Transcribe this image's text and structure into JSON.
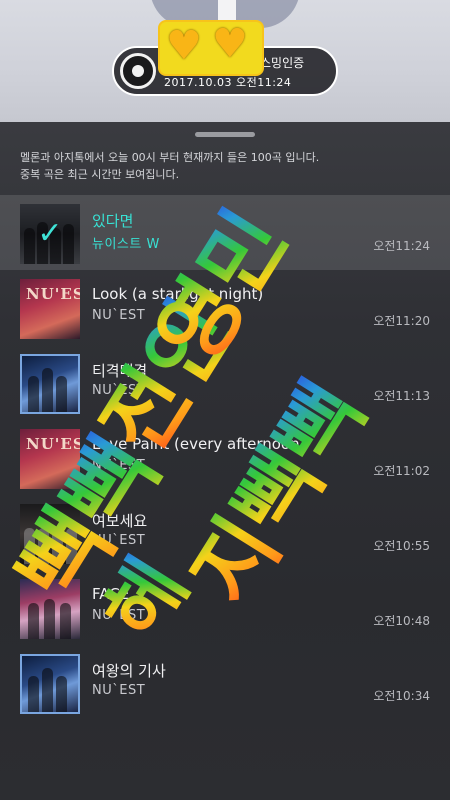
{
  "now_playing": {
    "title": "스밍인증",
    "title_prefix": "",
    "datetime": "2017.10.03 오전11:24"
  },
  "notice": {
    "line1": "멜론과 아지톡에서 오늘 00시 부터 현재까지 들은 100곡 입니다.",
    "line2": "중복 곡은 최근 시간만 보여집니다."
  },
  "songs": [
    {
      "title": "있다면",
      "artist": "뉴이스트 W",
      "time": "오전11:24",
      "selected": true
    },
    {
      "title": "Look (a starlight night)",
      "artist": "NU`EST",
      "time": "오전11:20"
    },
    {
      "title": "티격태격",
      "artist": "NU`EST",
      "time": "오전11:13"
    },
    {
      "title": "Love Paint (every afternoon)",
      "artist": "NU`EST",
      "time": "오전11:02"
    },
    {
      "title": "여보세요",
      "artist": "NU`EST",
      "time": "오전10:55"
    },
    {
      "title": "FACE",
      "artist": "NU`EST",
      "time": "오전10:48"
    },
    {
      "title": "여왕의 기사",
      "artist": "NU`EST",
      "time": "오전10:34"
    }
  ],
  "album_logos": {
    "nuest": "NU'EST"
  },
  "overlay_text": {
    "left_column": "빽빽",
    "middle_column": "전인",
    "right_column": "영민",
    "far_column": "지빽빽",
    "extra": "헤"
  },
  "colors": {
    "accent": "#38e0d3",
    "sheet_bg": "#2a2b30",
    "pill_border": "#ffffff",
    "sticker": "#f2da1e"
  }
}
